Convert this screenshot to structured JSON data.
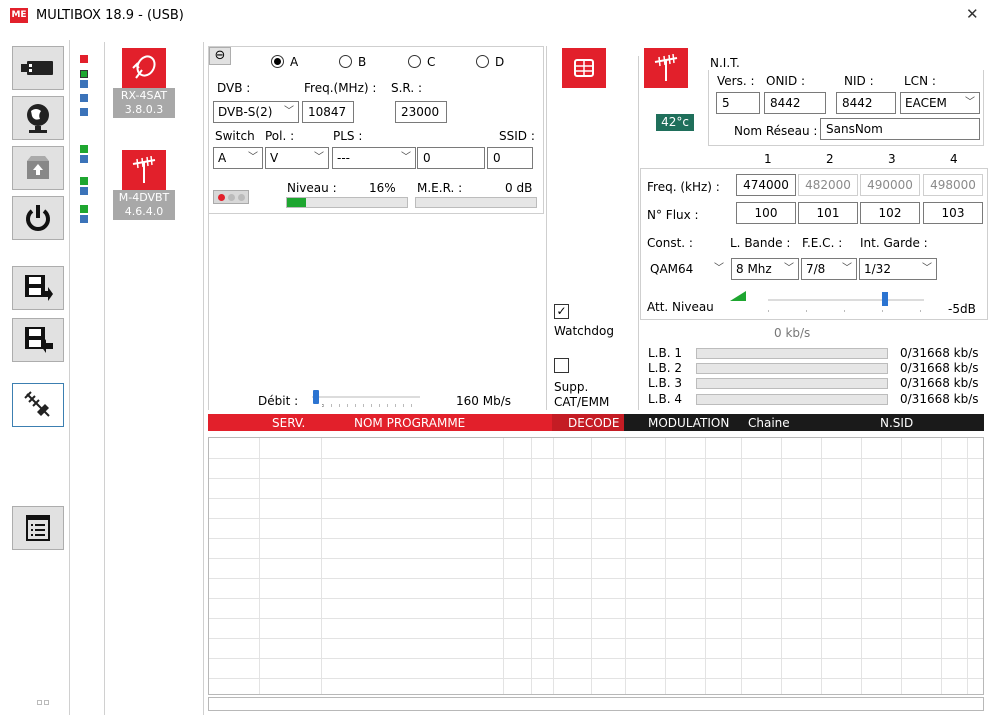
{
  "window": {
    "title": "MULTIBOX 18.9 - (USB)",
    "close_glyph": "✕",
    "app_logo": "ME"
  },
  "modules": [
    {
      "name": "RX-4SAT",
      "version": "3.8.0.3"
    },
    {
      "name": "M-4DVBT",
      "version": "4.6.4.0"
    }
  ],
  "sat": {
    "inputs": [
      "A",
      "B",
      "C",
      "D"
    ],
    "selected_input": "A",
    "dvb_label": "DVB :",
    "dvb_value": "DVB-S(2)",
    "freq_label": "Freq.(MHz) :",
    "freq_value": "10847",
    "sr_label": "S.R. :",
    "sr_value": "23000",
    "switch_label": "Switch",
    "switch_value": "A",
    "pol_label": "Pol. :",
    "pol_value": "V",
    "pls_label": "PLS :",
    "pls_value": "---",
    "pls_num": "0",
    "ssid_label": "SSID :",
    "ssid_value": "0",
    "niveau_label": "Niveau :",
    "niveau_value": "16%",
    "niveau_level": 0.16,
    "mer_label": "M.E.R. :",
    "mer_value": "0 dB",
    "debit_label": "Débit :",
    "debit_value": "160 Mb/s"
  },
  "watchdog_label": "Watchdog",
  "supp_label_1": "Supp.",
  "supp_label_2": "CAT/EMM",
  "nit": {
    "title": "N.I.T.",
    "vers_label": "Vers. :",
    "vers_value": "5",
    "onid_label": "ONID :",
    "onid_value": "8442",
    "nid_label": "NID :",
    "nid_value": "8442",
    "lcn_label": "LCN :",
    "lcn_value": "EACEM",
    "nom_label": "Nom Réseau :",
    "nom_value": "SansNom",
    "temp": "42°c"
  },
  "dvbt": {
    "cols": [
      "1",
      "2",
      "3",
      "4"
    ],
    "freq_label": "Freq. (kHz) :",
    "freqs": [
      "474000",
      "482000",
      "490000",
      "498000"
    ],
    "flux_label": "N° Flux :",
    "flux": [
      "100",
      "101",
      "102",
      "103"
    ],
    "const_label": "Const. :",
    "const_value": "QAM64",
    "lbande_label": "L. Bande :",
    "lbande_value": "8 Mhz",
    "fec_label": "F.E.C. :",
    "fec_value": "7/8",
    "garde_label": "Int. Garde :",
    "garde_value": "1/32",
    "att_label": "Att. Niveau",
    "att_value": "-5dB",
    "kbs": "0 kb/s",
    "lb": [
      {
        "label": "L.B. 1",
        "value": "0/31668 kb/s"
      },
      {
        "label": "L.B. 2",
        "value": "0/31668 kb/s"
      },
      {
        "label": "L.B. 3",
        "value": "0/31668 kb/s"
      },
      {
        "label": "L.B. 4",
        "value": "0/31668 kb/s"
      }
    ]
  },
  "table": {
    "headers": {
      "serv": "SERV.",
      "nom": "NOM PROGRAMME",
      "decode": "DECODE",
      "modulation": "MODULATION",
      "chaine": "Chaine",
      "nsid": "N.SID"
    }
  },
  "colors": {
    "accent_red": "#e2202b",
    "header_dark": "#1a1a1a",
    "level_green": "#1ea630",
    "temp_bg": "#1f6f5b"
  },
  "icons": {
    "usb": "usb-icon",
    "globe": "globe-network-icon",
    "firmware": "firmware-box-icon",
    "power": "power-icon",
    "save_out": "save-export-icon",
    "save_in": "save-import-icon",
    "antenna_tool": "antenna-tool-icon",
    "list": "list-icon"
  }
}
